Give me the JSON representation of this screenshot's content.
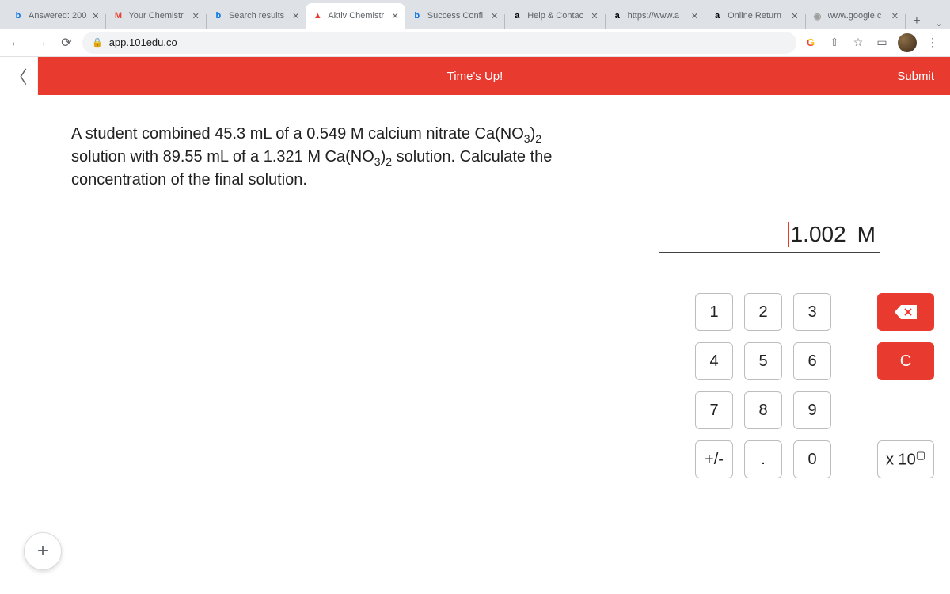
{
  "tabs": [
    {
      "favicon": "b",
      "fcolor": "#0073e6",
      "title": "Answered: 200"
    },
    {
      "favicon": "M",
      "fcolor": "#ea4335",
      "title": "Your Chemistr"
    },
    {
      "favicon": "b",
      "fcolor": "#0073e6",
      "title": "Search results"
    },
    {
      "favicon": "▲",
      "fcolor": "#e93a30",
      "title": "Aktiv Chemistr",
      "active": true
    },
    {
      "favicon": "b",
      "fcolor": "#0073e6",
      "title": "Success Confi"
    },
    {
      "favicon": "a",
      "fcolor": "#000",
      "title": "Help & Contac"
    },
    {
      "favicon": "a",
      "fcolor": "#000",
      "title": "https://www.a"
    },
    {
      "favicon": "a",
      "fcolor": "#000",
      "title": "Online Return"
    },
    {
      "favicon": "◉",
      "fcolor": "#9e9e9e",
      "title": "www.google.c"
    }
  ],
  "url": "app.101edu.co",
  "header": {
    "status": "Time's Up!",
    "submit": "Submit"
  },
  "question": {
    "p1a": "A student combined 45.3 mL of a 0.549 M calcium nitrate Ca(NO",
    "p1b": ")",
    "p2a": "solution with 89.55 mL of a 1.321 M Ca(NO",
    "p2b": ")",
    "p2c": " solution. Calculate the concentration of the final solution."
  },
  "answer": {
    "value": "1.002",
    "unit": "M"
  },
  "keys": {
    "k1": "1",
    "k2": "2",
    "k3": "3",
    "k4": "4",
    "k5": "5",
    "k6": "6",
    "k7": "7",
    "k8": "8",
    "k9": "9",
    "pm": "+/-",
    "dot": ".",
    "k0": "0",
    "clear": "C",
    "exp_prefix": "x 10"
  }
}
